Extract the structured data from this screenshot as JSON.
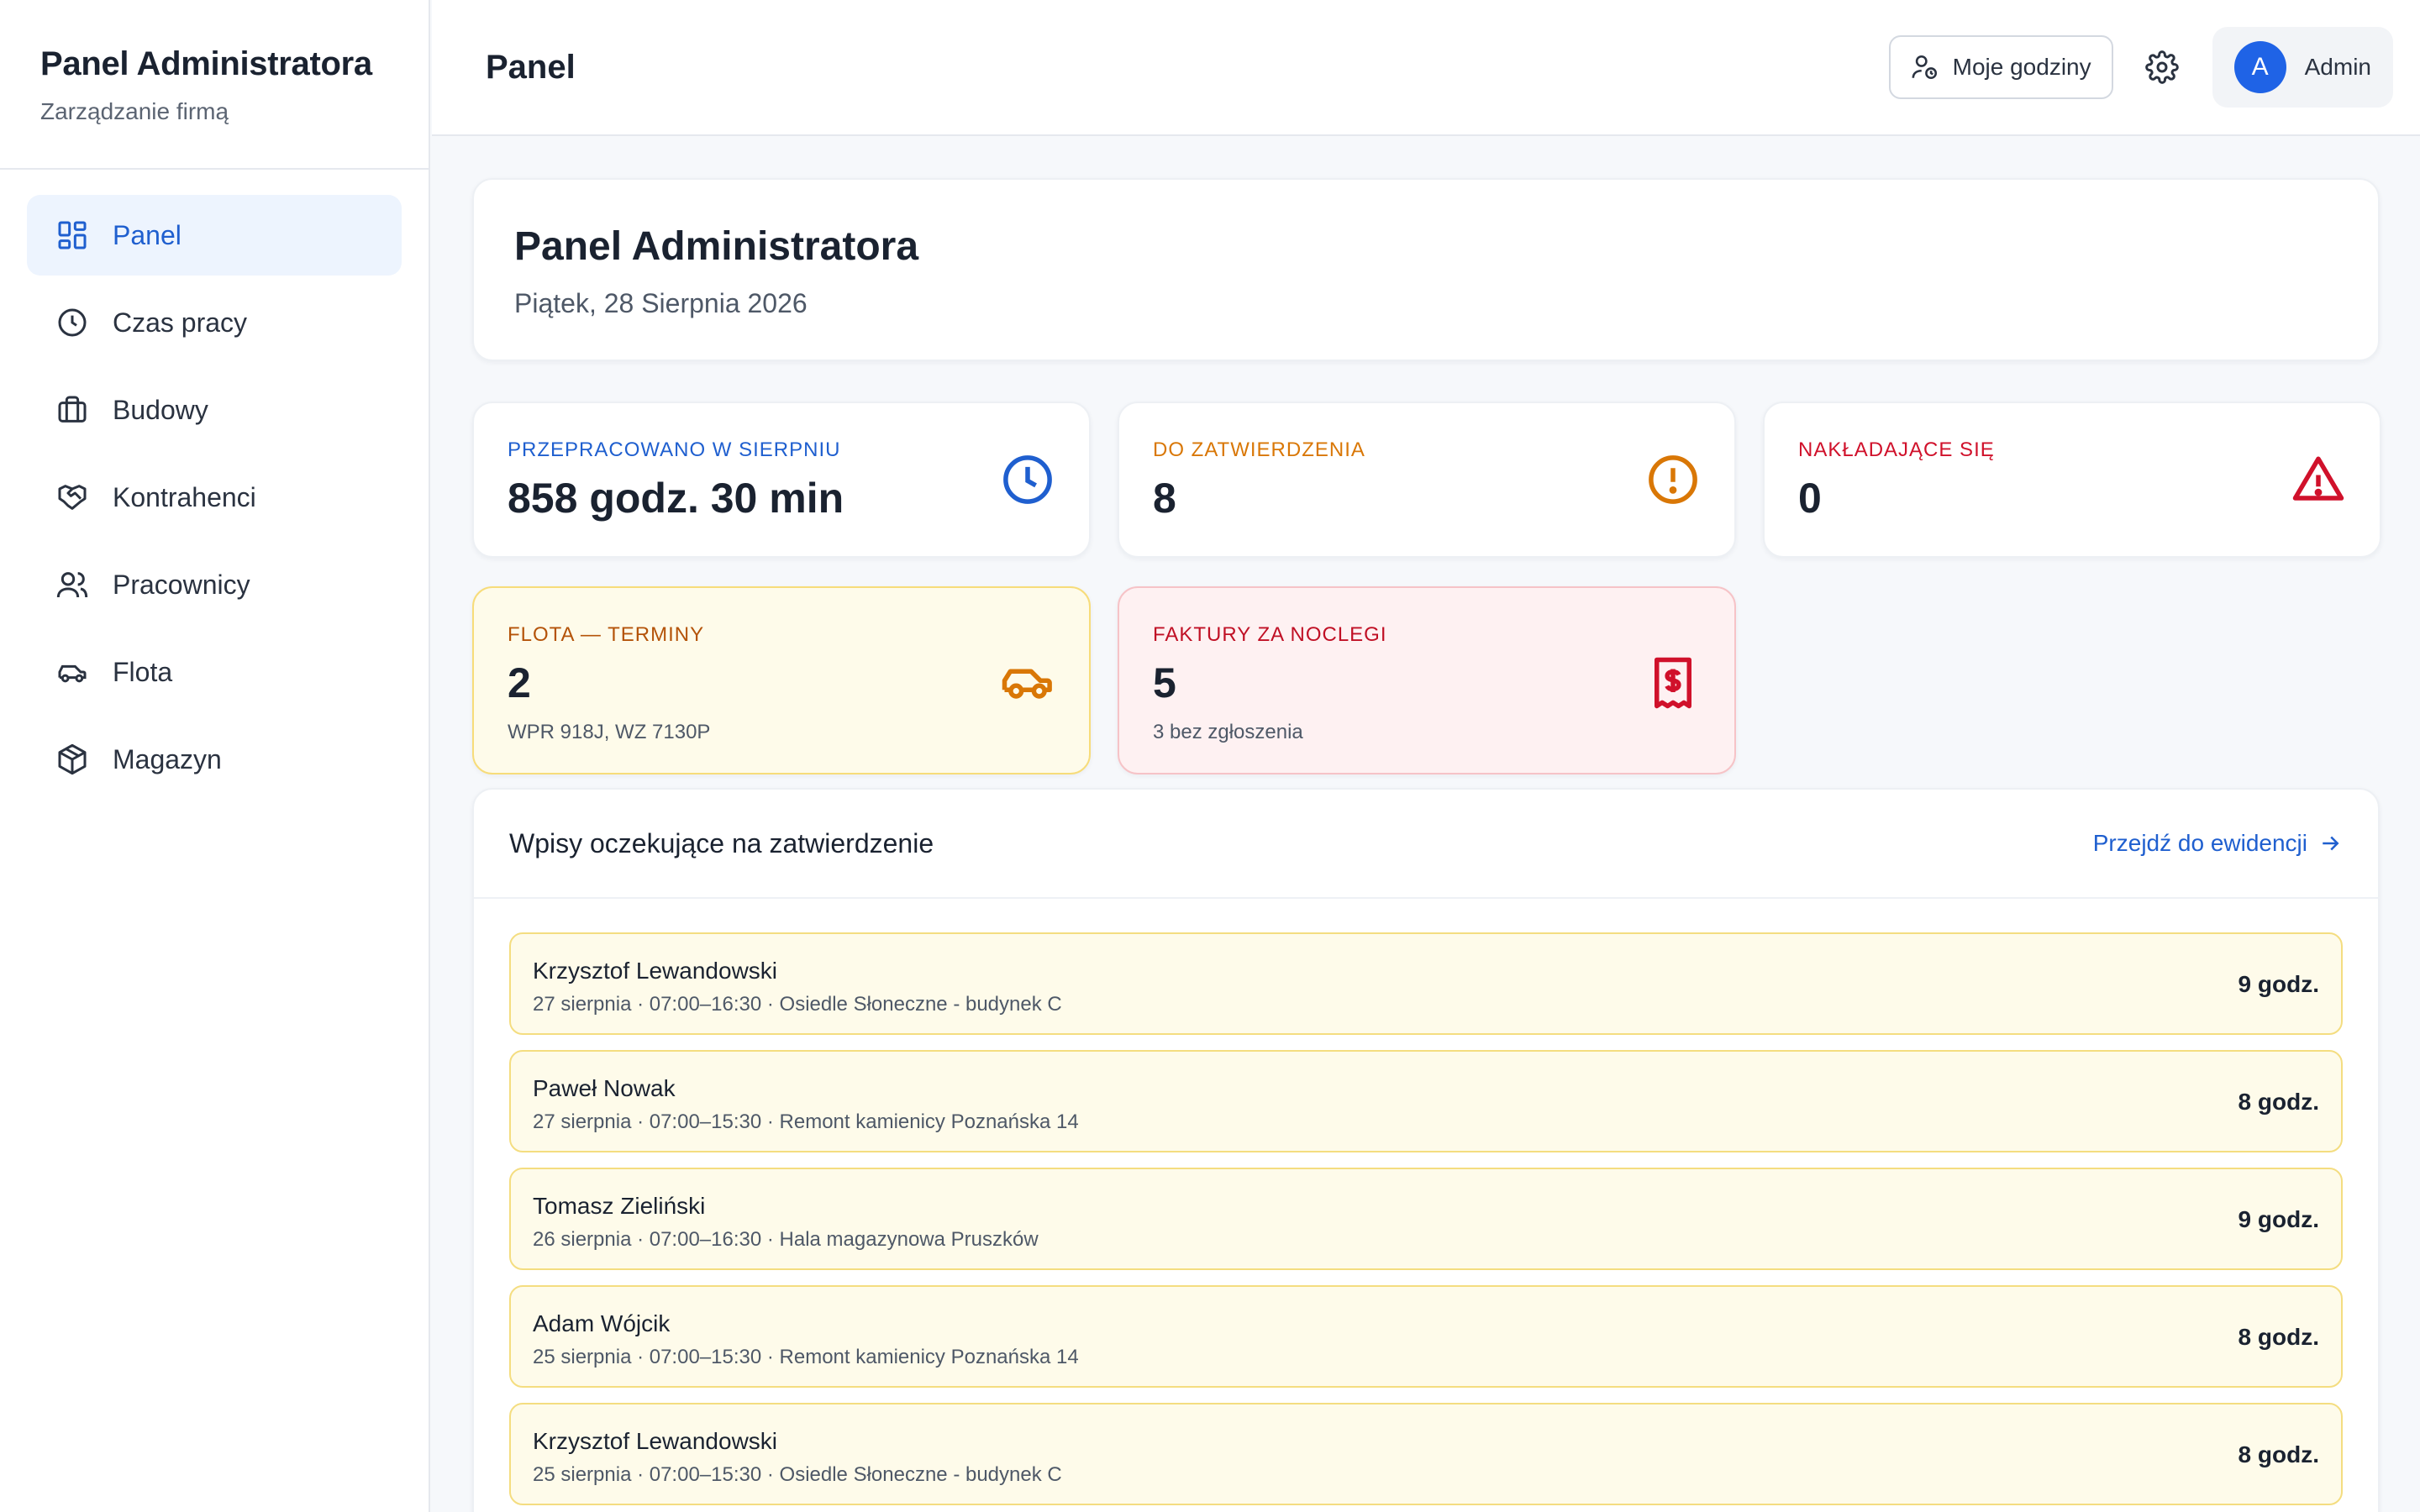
{
  "sidebar": {
    "title": "Panel Administratora",
    "subtitle": "Zarządzanie firmą",
    "items": [
      {
        "label": "Panel",
        "icon": "dashboard-icon"
      },
      {
        "label": "Czas pracy",
        "icon": "clock-icon"
      },
      {
        "label": "Budowy",
        "icon": "briefcase-icon"
      },
      {
        "label": "Kontrahenci",
        "icon": "handshake-icon"
      },
      {
        "label": "Pracownicy",
        "icon": "users-icon"
      },
      {
        "label": "Flota",
        "icon": "car-icon"
      },
      {
        "label": "Magazyn",
        "icon": "package-icon"
      }
    ]
  },
  "header": {
    "title": "Panel",
    "my_hours_label": "Moje godziny",
    "user_initial": "A",
    "user_name": "Admin"
  },
  "welcome": {
    "title": "Panel Administratora",
    "date": "Piątek, 28 Sierpnia 2026"
  },
  "stats": {
    "worked": {
      "label": "PRZEPRACOWANO W SIERPNIU",
      "value": "858 godz. 30 min"
    },
    "to_approve": {
      "label": "DO ZATWIERDZENIA",
      "value": "8"
    },
    "overlapping": {
      "label": "NAKŁADAJĄCE SIĘ",
      "value": "0"
    },
    "fleet": {
      "label": "FLOTA — TERMINY",
      "value": "2",
      "sub": "WPR 918J, WZ 7130P"
    },
    "invoices": {
      "label": "FAKTURY ZA NOCLEGI",
      "value": "5",
      "sub": "3 bez zgłoszenia"
    }
  },
  "pending": {
    "title": "Wpisy oczekujące na zatwierdzenie",
    "link_label": "Przejdź do ewidencji",
    "rows": [
      {
        "name": "Krzysztof Lewandowski",
        "detail": "27 sierpnia · 07:00–16:30 · Osiedle Słoneczne - budynek C",
        "hours": "9 godz."
      },
      {
        "name": "Paweł Nowak",
        "detail": "27 sierpnia · 07:00–15:30 · Remont kamienicy Poznańska 14",
        "hours": "8 godz."
      },
      {
        "name": "Tomasz Zieliński",
        "detail": "26 sierpnia · 07:00–16:30 · Hala magazynowa Pruszków",
        "hours": "9 godz."
      },
      {
        "name": "Adam Wójcik",
        "detail": "25 sierpnia · 07:00–15:30 · Remont kamienicy Poznańska 14",
        "hours": "8 godz."
      },
      {
        "name": "Krzysztof Lewandowski",
        "detail": "25 sierpnia · 07:00–15:30 · Osiedle Słoneczne - budynek C",
        "hours": "8 godz."
      }
    ]
  },
  "colors": {
    "accent_blue": "#1f5fcf",
    "warning_orange": "#d97706",
    "danger_red": "#d0112b",
    "fleet_label": "#b45309",
    "invoice_label": "#c01025"
  }
}
